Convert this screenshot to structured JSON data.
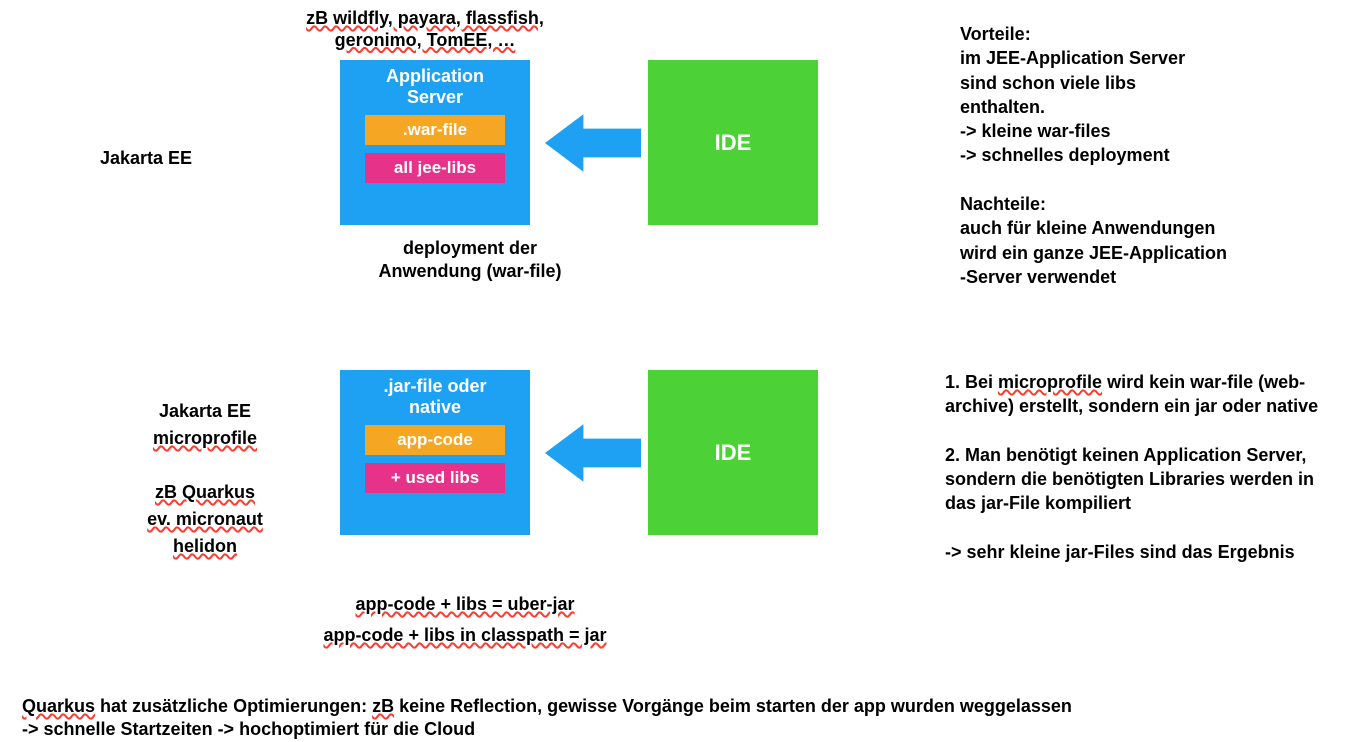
{
  "top_examples_line1": "zB wildfly, payara, flassfish,",
  "top_examples_line2": "geronimo, TomEE, …",
  "row1_label": "Jakarta EE",
  "app_server_title_l1": "Application",
  "app_server_title_l2": "Server",
  "war_label": ".war-file",
  "libs_label": "all jee-libs",
  "ide_label": "IDE",
  "deploy_caption_l1": "deployment der",
  "deploy_caption_l2": "Anwendung (war-file)",
  "row2_label_l1": "Jakarta EE",
  "row2_label_l2": "microprofile",
  "row2_label_l3": "zB Quarkus",
  "row2_label_l4": "ev. micronaut",
  "row2_label_l5": "helidon",
  "jar_title_l1": ".jar-file oder",
  "jar_title_l2": "native",
  "appcode_label": "app-code",
  "usedlibs_label": "+ used libs",
  "uber_caption": "app-code + libs = uber-jar",
  "jar_caption": "app-code + libs in classpath = jar",
  "right_top": {
    "h1": "Vorteile:",
    "l1": "im JEE-Application Server",
    "l2": "sind schon viele libs",
    "l3": "enthalten.",
    "l4": "-> kleine war-files",
    "l5": "-> schnelles deployment",
    "h2": "Nachteile:",
    "l6": "auch für kleine Anwendungen",
    "l7": "wird ein ganze JEE-Application",
    "l8": "-Server verwendet"
  },
  "right_bottom": {
    "p1a": "1. Bei ",
    "p1b": "microprofile",
    "p1c": " wird kein war-file (web-archive) erstellt, sondern ein jar oder native",
    "p2": "2. Man benötigt keinen Application Server, sondern die benötigten Libraries werden in das jar-File kompiliert",
    "p3": "-> sehr kleine jar-Files sind das Ergebnis"
  },
  "footer_l1a": "Quarkus",
  "footer_l1b": " hat zusätzliche Optimierungen: ",
  "footer_l1c": "zB",
  "footer_l1d": " keine Reflection, gewisse Vorgänge beim starten der app wurden weggelassen",
  "footer_l2": "-> schnelle Startzeiten -> hochoptimiert für die Cloud"
}
